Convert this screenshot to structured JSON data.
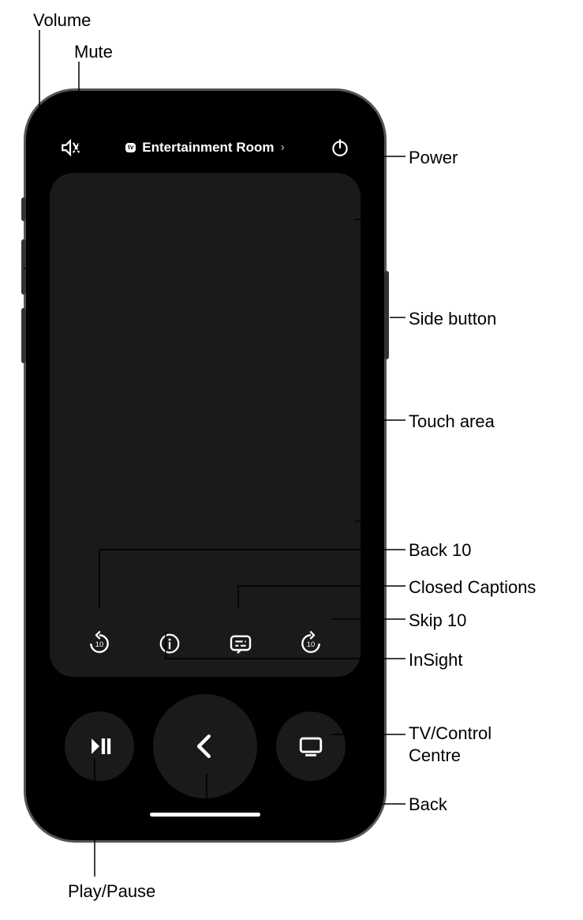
{
  "device": {
    "selector_label": "Entertainment Room",
    "tv_badge": "tv"
  },
  "callouts": {
    "volume": "Volume",
    "mute": "Mute",
    "power": "Power",
    "side_button": "Side button",
    "touch_area": "Touch area",
    "back10": "Back 10",
    "closed_captions": "Closed Captions",
    "skip10": "Skip 10",
    "insight": "InSight",
    "tv_control": "TV/Control\nCentre",
    "back": "Back",
    "play_pause": "Play/Pause"
  }
}
